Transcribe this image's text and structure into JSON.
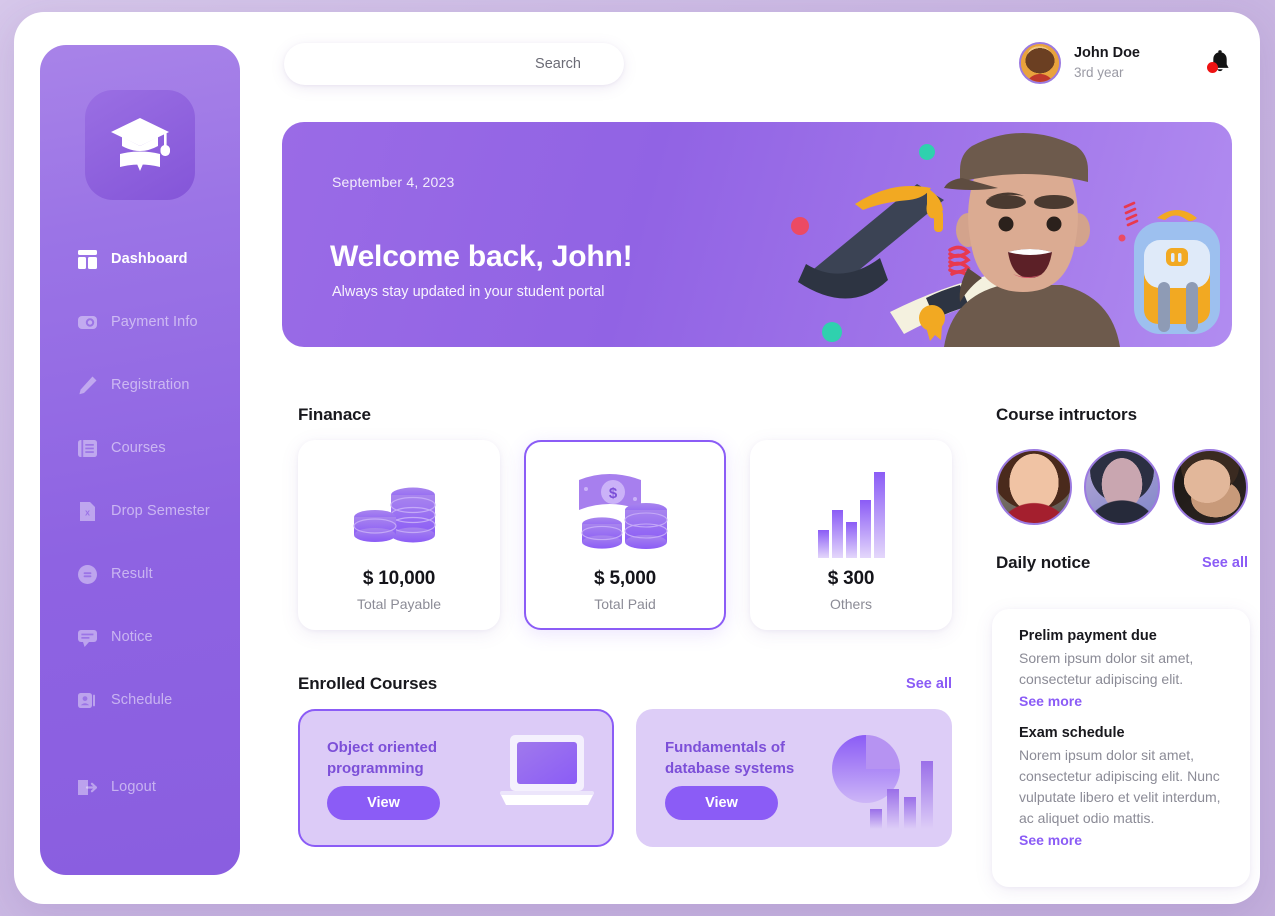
{
  "colors": {
    "brand_purple": "#8b5cf6",
    "sidebar_purple": "#9b74e6",
    "page_bg": "#c4b0dd",
    "notice_link": "#8b5cf6",
    "alert_red": "#ee1212"
  },
  "sidebar": {
    "logo_icon": "graduation-cap-diploma-icon",
    "items": [
      {
        "label": "Dashboard",
        "icon": "dashboard-icon",
        "active": true
      },
      {
        "label": "Payment Info",
        "icon": "payment-icon",
        "active": false
      },
      {
        "label": "Registration",
        "icon": "pencil-icon",
        "active": false
      },
      {
        "label": "Courses",
        "icon": "book-list-icon",
        "active": false
      },
      {
        "label": "Drop Semester",
        "icon": "file-x-icon",
        "active": false
      },
      {
        "label": "Result",
        "icon": "result-circle-icon",
        "active": false
      },
      {
        "label": "Notice",
        "icon": "chat-bubble-icon",
        "active": false
      },
      {
        "label": "Schedule",
        "icon": "id-card-icon",
        "active": false
      }
    ],
    "logout": {
      "label": "Logout",
      "icon": "logout-icon"
    }
  },
  "header": {
    "search": {
      "value": "",
      "placeholder": "Search",
      "icon": "search-icon"
    },
    "user": {
      "name": "John Doe",
      "meta": "3rd year",
      "avatar": "user-avatar"
    },
    "notification": {
      "icon": "bell-icon",
      "has_unread": true
    }
  },
  "banner": {
    "date": "September 4,  2023",
    "title": "Welcome back, John!",
    "subtitle": "Always stay updated in your student portal",
    "illustration": "student-3d-illustration"
  },
  "finance": {
    "title": "Finanace",
    "cards": [
      {
        "amount": "$ 10,000",
        "label": "Total Payable",
        "icon": "coin-stacks-icon",
        "selected": false
      },
      {
        "amount": "$ 5,000",
        "label": "Total Paid",
        "icon": "money-coins-icon",
        "selected": true
      },
      {
        "amount": "$ 300",
        "label": "Others",
        "icon": "bar-chart-icon",
        "selected": false
      }
    ]
  },
  "enrolled_courses": {
    "title": "Enrolled Courses",
    "see_all_label": "See all",
    "cards": [
      {
        "name": "Object oriented programming",
        "button_label": "View",
        "icon": "laptop-icon",
        "selected": true
      },
      {
        "name": "Fundamentals of database systems",
        "button_label": "View",
        "icon": "pie-bar-chart-icon",
        "selected": false
      }
    ]
  },
  "instructors": {
    "title": "Course intructors",
    "people": [
      {
        "alt": "instructor-1-photo"
      },
      {
        "alt": "instructor-2-photo"
      },
      {
        "alt": "instructor-3-photo"
      }
    ]
  },
  "daily_notice": {
    "title": "Daily notice",
    "see_all_label": "See all",
    "items": [
      {
        "title": "Prelim payment due",
        "body": "Sorem ipsum dolor sit amet, consectetur adipiscing elit.",
        "more_label": "See more"
      },
      {
        "title": "Exam schedule",
        "body": "Norem ipsum dolor sit amet, consectetur adipiscing elit. Nunc vulputate libero et velit interdum, ac aliquet odio mattis.",
        "more_label": "See more"
      }
    ]
  }
}
